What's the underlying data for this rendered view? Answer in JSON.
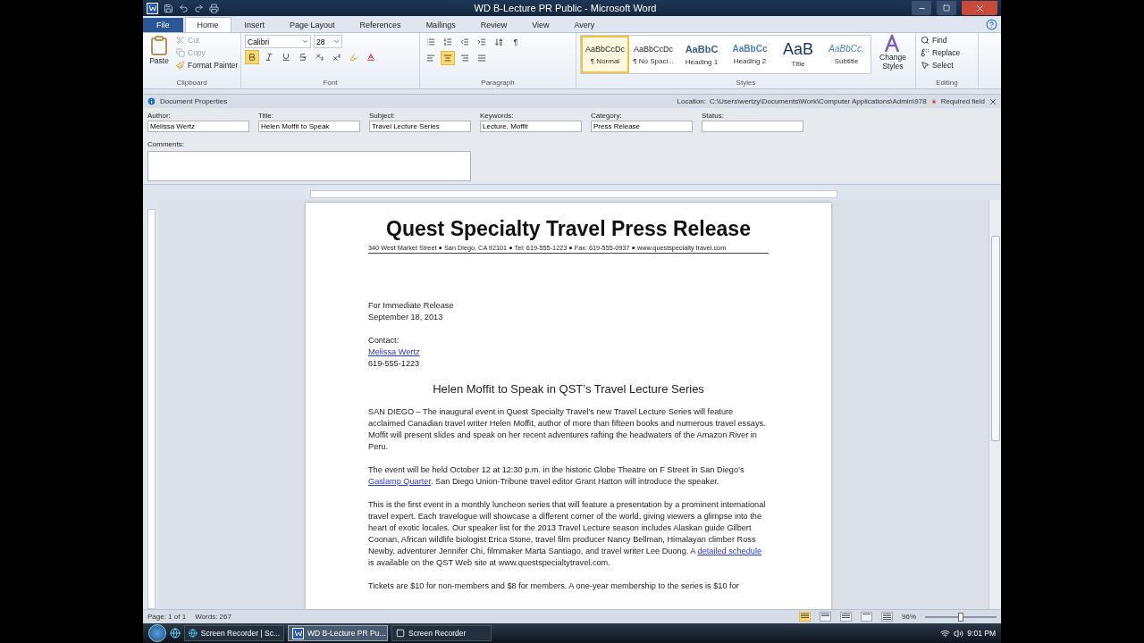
{
  "window": {
    "title": "WD B-Lecture PR Public  -  Microsoft Word"
  },
  "tabs": [
    {
      "label": "File",
      "kind": "file",
      "selected": false
    },
    {
      "label": "Home",
      "kind": "tab",
      "selected": true
    },
    {
      "label": "Insert",
      "kind": "tab",
      "selected": false
    },
    {
      "label": "Page Layout",
      "kind": "tab",
      "selected": false
    },
    {
      "label": "References",
      "kind": "tab",
      "selected": false
    },
    {
      "label": "Mailings",
      "kind": "tab",
      "selected": false
    },
    {
      "label": "Review",
      "kind": "tab",
      "selected": false
    },
    {
      "label": "View",
      "kind": "tab",
      "selected": false
    },
    {
      "label": "Avery",
      "kind": "tab",
      "selected": false
    }
  ],
  "clipboard": {
    "paste": "Paste",
    "cut": "Cut",
    "copy": "Copy",
    "format_painter": "Format Painter",
    "group": "Clipboard"
  },
  "font": {
    "name": "Calibri",
    "size": "28",
    "bold": true,
    "italic": false,
    "underline": false,
    "group": "Font"
  },
  "paragraph": {
    "alignments": [
      {
        "kind": "left",
        "selected": false
      },
      {
        "kind": "center",
        "selected": true
      },
      {
        "kind": "right",
        "selected": false
      },
      {
        "kind": "justify",
        "selected": false
      }
    ],
    "group": "Paragraph",
    "show_marks": "¶"
  },
  "styles": {
    "items": [
      {
        "sample": "AaBbCcDc",
        "label": "¶ Normal",
        "kind": "normal",
        "selected": true
      },
      {
        "sample": "AaBbCcDc",
        "label": "¶ No Spaci...",
        "kind": "normal",
        "selected": false
      },
      {
        "sample": "AaBbC",
        "label": "Heading 1",
        "kind": "heading1",
        "selected": false
      },
      {
        "sample": "AaBbCc",
        "label": "Heading 2",
        "kind": "heading2",
        "selected": false
      },
      {
        "sample": "AaB",
        "label": "Title",
        "kind": "title",
        "selected": false
      },
      {
        "sample": "AaBbCc.",
        "label": "Subtitle",
        "kind": "subtitle",
        "selected": false
      }
    ],
    "change": "Change Styles",
    "group": "Styles"
  },
  "editing": {
    "find": "Find",
    "replace": "Replace",
    "select": "Select",
    "group": "Editing"
  },
  "document_properties": {
    "title": "Document Properties",
    "location_label": "Location:",
    "location": "C:\\Users\\wertzy\\Documents\\Work\\Computer Applications\\Admin\\978",
    "required": "Required field",
    "fields": [
      {
        "label": "Author:",
        "value": "Melissa Wertz"
      },
      {
        "label": "Title:",
        "value": "Helen Moffit to Speak"
      },
      {
        "label": "Subject:",
        "value": "Travel Lecture Series"
      },
      {
        "label": "Keywords:",
        "value": "Lecture, Moffit"
      },
      {
        "label": "Category:",
        "value": "Press Release"
      },
      {
        "label": "Status:"
      }
    ],
    "comments_label": "Comments:"
  },
  "document": {
    "heading": "Quest Specialty Travel Press Release",
    "address": "340 West Market Street ● San Diego, CA 92101 ● Tel: 619-555-1223 ● Fax: 619-555-0937 ● www.questspecialty travel.com",
    "release_lines": [
      "For Immediate Release",
      "September 18, 2013"
    ],
    "contact_label": "Contact:",
    "contact_name": "Melissa Wertz",
    "contact_phone": "619-555-1223",
    "subheading": "Helen Moffit to Speak in QST’s Travel Lecture Series",
    "paragraphs": [
      [
        {
          "kind": "text",
          "text": "SAN DIEGO – The inaugural event in Quest Specialty Travel’s new Travel Lecture Series will feature acclaimed Canadian travel writer Helen Moffit, author of more than fifteen books and numerous travel essays. Moffit will present slides and speak on her recent adventures rafting the headwaters of the Amazon River in Peru."
        }
      ],
      [
        {
          "kind": "text",
          "text": "The event will be held October 12 at 12:30 p.m. in the historic Globe Theatre on F Street in San Diego’s "
        },
        {
          "kind": "link",
          "text": "Gaslamp Quarter"
        },
        {
          "kind": "text",
          "text": ". San Diego Union-Tribune  travel editor Grant Hatton will introduce the speaker."
        }
      ],
      [
        {
          "kind": "text",
          "text": "This is the first event in a monthly luncheon series that will feature a presentation by a prominent international travel expert. Each travelogue will showcase a different corner of the world, giving viewers a glimpse into the heart of exotic locales. Our speaker list for the 2013 Travel Lecture season includes Alaskan guide Gilbert Coonan, African wildlife biologist Erica Stone, travel film producer Nancy Bellman, Himalayan climber Ross Newby, adventurer Jennifer Chi, filmmaker Marta Santiago, and travel writer Lee Duong. A "
        },
        {
          "kind": "link",
          "text": "detailed schedule"
        },
        {
          "kind": "text",
          "text": " is available on the QST Web site at www.questspecialtytravel.com."
        }
      ],
      [
        {
          "kind": "text",
          "text": "Tickets are $10 for non-members and $8 for members. A one-year membership to the series is $10 for"
        }
      ]
    ]
  },
  "status_bar": {
    "page": "Page: 1 of 1",
    "words": "Words: 267",
    "zoom": "96%",
    "level": 0.5,
    "views": [
      {
        "selected": true
      },
      {
        "selected": false
      },
      {
        "selected": false
      },
      {
        "selected": false
      },
      {
        "selected": false
      }
    ]
  },
  "taskbar": {
    "items": [
      {
        "label": "Screen Recorder | Sc...",
        "kind": "browser",
        "selected": false
      },
      {
        "label": "WD B-Lecture PR Pu...",
        "kind": "word",
        "selected": true
      },
      {
        "label": "Screen Recorder",
        "kind": "recorder",
        "selected": false
      }
    ],
    "time": "9:01 PM"
  }
}
